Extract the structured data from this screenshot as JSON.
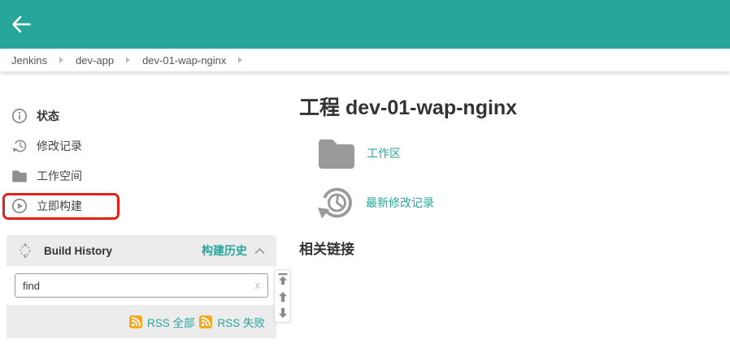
{
  "header": {
    "back_icon": "arrow-left"
  },
  "breadcrumb": {
    "items": [
      "Jenkins",
      "dev-app",
      "dev-01-wap-nginx"
    ],
    "separator_icon": "chevron-right"
  },
  "sidebar": {
    "items": [
      {
        "label": "状态",
        "icon": "info-icon",
        "active": true
      },
      {
        "label": "修改记录",
        "icon": "history-icon"
      },
      {
        "label": "工作空间",
        "icon": "folder-icon"
      },
      {
        "label": "立即构建",
        "icon": "play-icon",
        "highlighted": true
      }
    ],
    "build_history": {
      "title_en": "Build History",
      "title_zh": "构建历史",
      "panel_icon": "trend-icon",
      "collapse_icon": "chevron-up",
      "search_value": "find",
      "clear_label": "x",
      "rss_all": "RSS 全部",
      "rss_failures": "RSS 失败"
    }
  },
  "main": {
    "title": "工程 dev-01-wap-nginx",
    "workspace_link": "工作区",
    "changes_link": "最新修改记录",
    "section_heading": "相关链接"
  },
  "colors": {
    "header_teal": "#26a69a",
    "link_teal": "#26a69a",
    "icon_gray": "#8f8f8f",
    "panel_gray": "#ececec",
    "highlight_red": "#e32119",
    "rss_orange": "#f6a821"
  }
}
